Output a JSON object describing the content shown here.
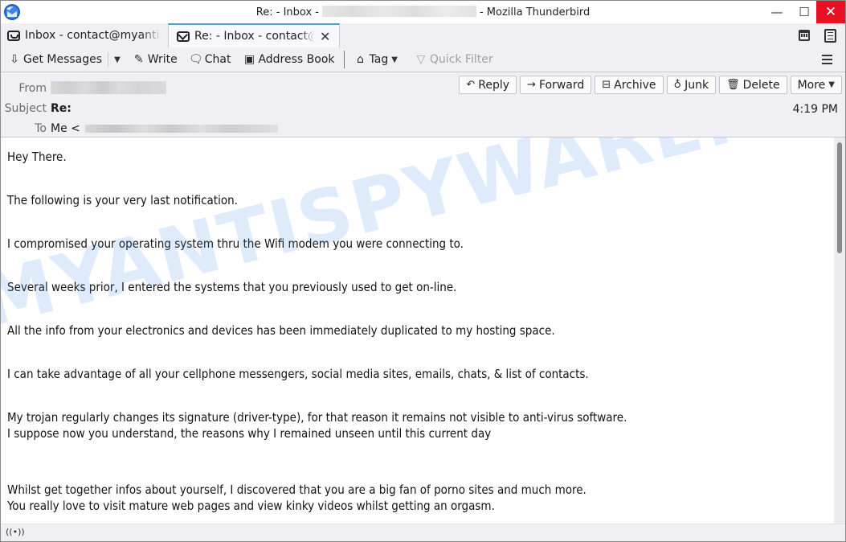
{
  "window": {
    "title_prefix": "Re: - Inbox -",
    "title_suffix": "- Mozilla Thunderbird",
    "minimize": "—",
    "maximize": "☐",
    "close": "✕"
  },
  "tabs": [
    {
      "label": "Inbox - contact@myantispyware.com",
      "icon": "inbox-icon",
      "active": false
    },
    {
      "label": "Re: - Inbox - contact@myantispyware.com",
      "icon": "envelope-icon",
      "active": true,
      "close": "✕"
    }
  ],
  "toolbar": {
    "get_messages": "Get Messages",
    "write": "Write",
    "chat": "Chat",
    "address_book": "Address Book",
    "tag": "Tag",
    "quick_filter": "Quick Filter"
  },
  "header": {
    "from_label": "From",
    "subject_label": "Subject",
    "to_label": "To",
    "subject": "Re:",
    "to_prefix": "Me <",
    "time": "4:19 PM",
    "buttons": {
      "reply": "Reply",
      "forward": "Forward",
      "archive": "Archive",
      "junk": "Junk",
      "delete": "Delete",
      "more": "More"
    }
  },
  "body": {
    "lines": [
      "Hey There.",
      "The following is your very last notification.",
      "I compromised your operating system thru the Wifi modem you were connecting to.",
      "Several weeks prior, I entered the systems that you previously used to get on-line.",
      "All the info from your electronics and devices has been immediately duplicated to my hosting space.",
      "I can take advantage of all your cellphone messengers, social media sites, emails, chats, & list of contacts.",
      "My trojan regularly changes its signature (driver-type), for that reason it remains not visible to anti-virus software.",
      "I suppose now you understand, the reasons why I remained unseen until this current day",
      "Whilst get together infos about yourself, I discovered that you are a big fan of porno sites and much more.",
      "You really love to visit mature web pages and view kinky videos whilst getting an orgasm."
    ],
    "watermark": "MYANTISPYWARE.COM"
  },
  "status": {
    "icon": "((•))"
  }
}
